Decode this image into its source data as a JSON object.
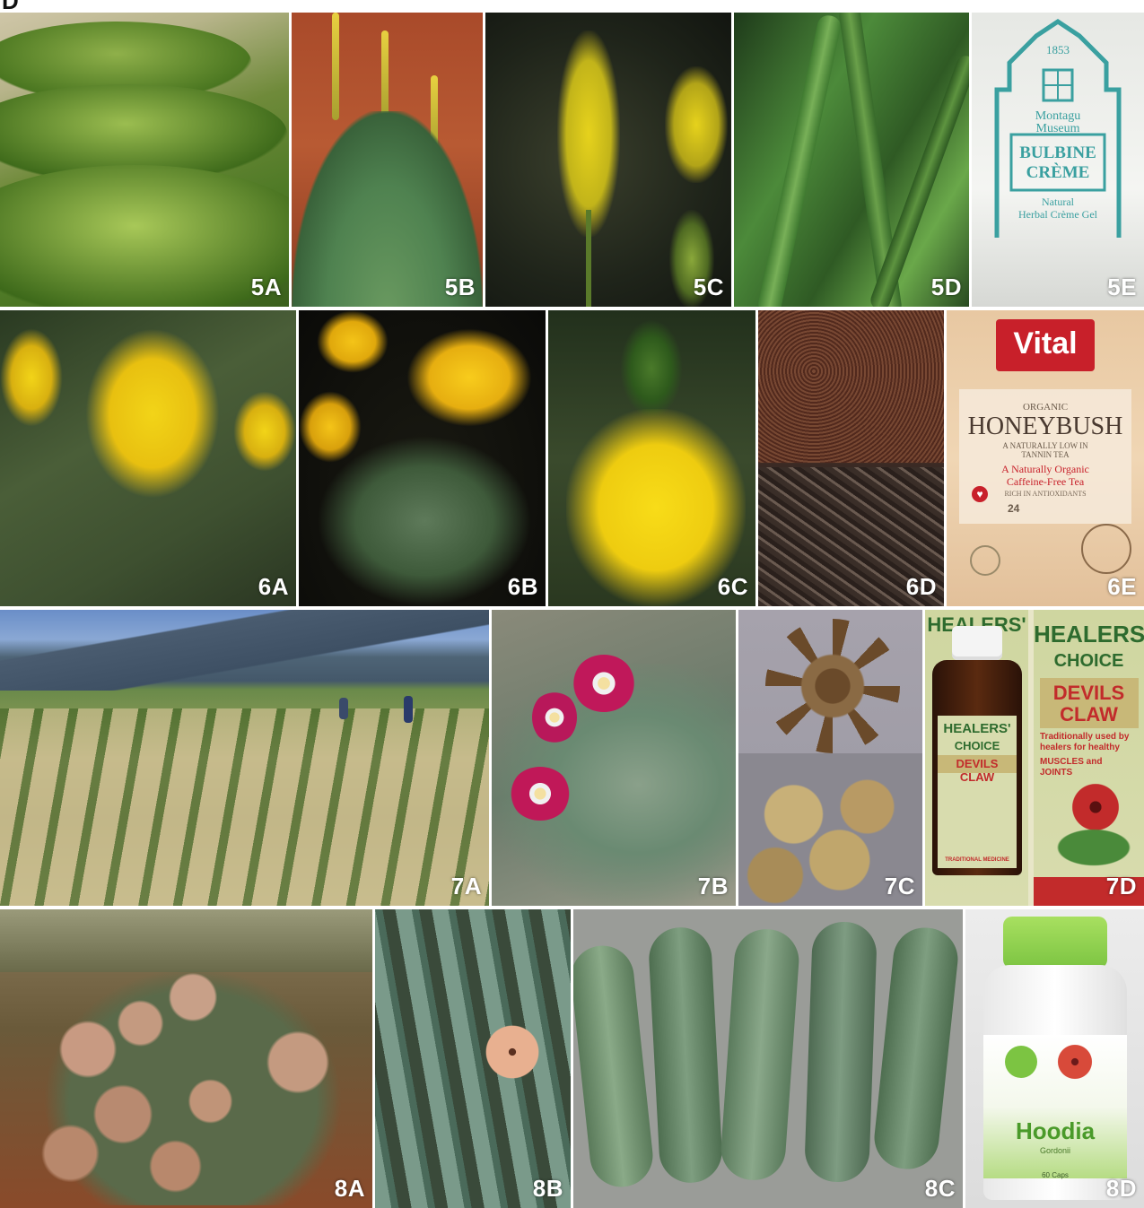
{
  "figure_letter": "D",
  "rows": [
    {
      "panels": [
        {
          "label": "5A",
          "description_icon": "grass-mounds-photo"
        },
        {
          "label": "5B",
          "description_icon": "bulbine-plant-photo"
        },
        {
          "label": "5C",
          "description_icon": "yellow-flower-spike-photo"
        },
        {
          "label": "5D",
          "description_icon": "succulent-leaves-photo"
        },
        {
          "label": "5E",
          "description_icon": "creme-jar-photo"
        }
      ]
    },
    {
      "panels": [
        {
          "label": "6A",
          "description_icon": "yellow-pea-flowers-photo"
        },
        {
          "label": "6B",
          "description_icon": "yellow-flowers-branch-photo"
        },
        {
          "label": "6C",
          "description_icon": "yellow-flower-raceme-photo"
        },
        {
          "label": "6D",
          "description_icon": "tea-leaves-photo"
        },
        {
          "label": "6E",
          "description_icon": "tea-box-photo"
        }
      ]
    },
    {
      "panels": [
        {
          "label": "7A",
          "description_icon": "field-rows-photo"
        },
        {
          "label": "7B",
          "description_icon": "pink-flowers-photo"
        },
        {
          "label": "7C",
          "description_icon": "dried-root-photo"
        },
        {
          "label": "7D",
          "description_icon": "product-boxes-photo"
        }
      ]
    },
    {
      "panels": [
        {
          "label": "8A",
          "description_icon": "hoodia-flowers-photo"
        },
        {
          "label": "8B",
          "description_icon": "hoodia-stems-photo"
        },
        {
          "label": "8C",
          "description_icon": "cut-stems-photo"
        },
        {
          "label": "8D",
          "description_icon": "capsule-bottle-photo"
        }
      ]
    }
  ],
  "products": {
    "bulbine": {
      "year": "1853",
      "museum_line1": "Montagu",
      "museum_line2": "Museum",
      "name_line1": "BULBINE",
      "name_line2": "CRÈME",
      "sub_line1": "Natural",
      "sub_line2": "Herbal Crème Gel",
      "color": "#3aa0a0"
    },
    "honeybush": {
      "brand": "Vital",
      "organic": "ORGANIC",
      "name": "HONEYBUSH",
      "tag1": "A NATURALLY LOW IN",
      "tag2": "TANNIN TEA",
      "tag3": "A Naturally Organic",
      "tag4": "Caffeine-Free Tea",
      "tag5": "RICH IN ANTIOXIDANTS",
      "count": "24"
    },
    "devils_claw": {
      "brand": "HEALERS'",
      "choice": "CHOICE",
      "name_line1": "DEVILS",
      "name_line2": "CLAW",
      "desc": "Traditionally used by healers for healthy",
      "desc2": "MUSCLES and",
      "desc3": "JOINTS",
      "bottle_brand": "HEALERS'",
      "bottle_choice": "CHOICE",
      "bottle_name": "DEVILS CLAW",
      "footer": "TRADITIONAL MEDICINE"
    },
    "hoodia": {
      "name": "Hoodia",
      "sub": "Gordonii",
      "count": "60 Caps"
    }
  },
  "colors": {
    "label": "#ffffff",
    "separator": "#ffffff",
    "teal": "#3aa0a0",
    "vital_red": "#c8202a",
    "healers_green": "#2e6b2e",
    "healers_red": "#c22b2b",
    "hoodia_green": "#7cc442"
  }
}
